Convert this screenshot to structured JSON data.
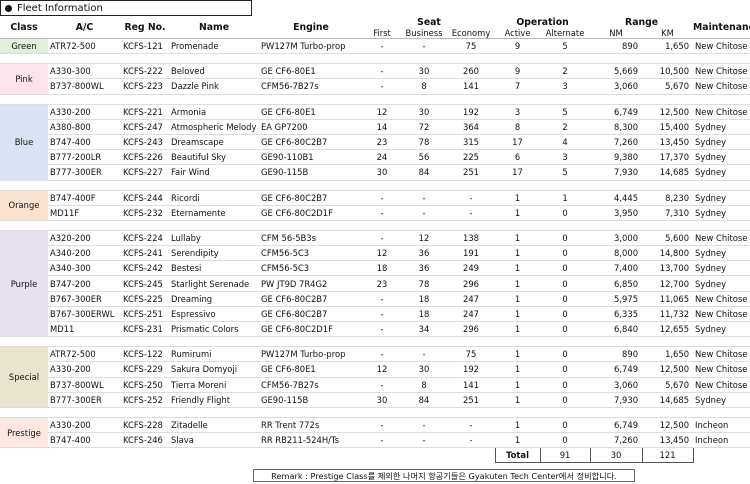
{
  "title": "Fleet Information",
  "headers": {
    "class": "Class",
    "ac": "A/C",
    "reg": "Reg No.",
    "name": "Name",
    "engine": "Engine",
    "seat": "Seat",
    "first": "First",
    "business": "Business",
    "economy": "Economy",
    "operation": "Operation",
    "active": "Active",
    "alternate": "Alternate",
    "range": "Range",
    "nm": "NM",
    "km": "KM",
    "maintenance": "Maintenance"
  },
  "groups": [
    {
      "class": "Green",
      "color": "#e2efda",
      "rows": [
        [
          "ATR72-500",
          "KCFS-121",
          "Promenade",
          "PW127M Turbo-prop",
          "-",
          "-",
          "75",
          "9",
          "5",
          "890",
          "1,650",
          "New Chitose"
        ]
      ]
    },
    {
      "class": "Pink",
      "color": "#fce4ec",
      "rows": [
        [
          "A330-300",
          "KCFS-222",
          "Beloved",
          "GE CF6-80E1",
          "-",
          "30",
          "260",
          "9",
          "2",
          "5,669",
          "10,500",
          "New Chitose"
        ],
        [
          "B737-800WL",
          "KCFS-223",
          "Dazzle Pink",
          "CFM56-7B27s",
          "-",
          "8",
          "141",
          "7",
          "3",
          "3,060",
          "5,670",
          "New Chitose"
        ]
      ]
    },
    {
      "class": "Blue",
      "color": "#dae3f3",
      "rows": [
        [
          "A330-200",
          "KCFS-221",
          "Armonia",
          "GE CF6-80E1",
          "12",
          "30",
          "192",
          "3",
          "5",
          "6,749",
          "12,500",
          "New Chitose"
        ],
        [
          "A380-800",
          "KCFS-247",
          "Atmospheric Melody",
          "EA GP7200",
          "14",
          "72",
          "364",
          "8",
          "2",
          "8,300",
          "15,400",
          "Sydney"
        ],
        [
          "B747-400",
          "KCFS-243",
          "Dreamscape",
          "GE CF6-80C2B7",
          "23",
          "78",
          "315",
          "17",
          "4",
          "7,260",
          "13,450",
          "Sydney"
        ],
        [
          "B777-200LR",
          "KCFS-226",
          "Beautiful Sky",
          "GE90-110B1",
          "24",
          "56",
          "225",
          "6",
          "3",
          "9,380",
          "17,370",
          "Sydney"
        ],
        [
          "B777-300ER",
          "KCFS-227",
          "Fair Wind",
          "GE90-115B",
          "30",
          "84",
          "251",
          "17",
          "5",
          "7,930",
          "14,685",
          "Sydney"
        ]
      ]
    },
    {
      "class": "Orange",
      "color": "#fbe3cf",
      "rows": [
        [
          "B747-400F",
          "KCFS-244",
          "Ricordi",
          "GE CF6-80C2B7",
          "-",
          "-",
          "-",
          "1",
          "1",
          "4,445",
          "8,230",
          "Sydney"
        ],
        [
          "MD11F",
          "KCFS-232",
          "Eternamente",
          "GE CF6-80C2D1F",
          "-",
          "-",
          "-",
          "1",
          "0",
          "3,950",
          "7,310",
          "Sydney"
        ]
      ]
    },
    {
      "class": "Purple",
      "color": "#e6e0ef",
      "rows": [
        [
          "A320-200",
          "KCFS-224",
          "Lullaby",
          "CFM 56-5B3s",
          "-",
          "12",
          "138",
          "1",
          "0",
          "3,000",
          "5,600",
          "New Chitose"
        ],
        [
          "A340-200",
          "KCFS-241",
          "Serendipity",
          "CFM56-5C3",
          "12",
          "36",
          "191",
          "1",
          "0",
          "8,000",
          "14,800",
          "Sydney"
        ],
        [
          "A340-300",
          "KCFS-242",
          "Bestesi",
          "CFM56-5C3",
          "18",
          "36",
          "249",
          "1",
          "0",
          "7,400",
          "13,700",
          "Sydney"
        ],
        [
          "B747-200",
          "KCFS-245",
          "Starlight Serenade",
          "PW JT9D 7R4G2",
          "23",
          "78",
          "296",
          "1",
          "0",
          "6,850",
          "12,700",
          "Sydney"
        ],
        [
          "B767-300ER",
          "KCFS-225",
          "Dreaming",
          "GE CF6-80C2B7",
          "-",
          "18",
          "247",
          "1",
          "0",
          "5,975",
          "11,065",
          "New Chitose"
        ],
        [
          "B767-300ERWL",
          "KCFS-251",
          "Espressivo",
          "GE CF6-80C2B7",
          "-",
          "18",
          "247",
          "1",
          "0",
          "6,335",
          "11,732",
          "New Chitose"
        ],
        [
          "MD11",
          "KCFS-231",
          "Prismatic Colors",
          "GE CF6-80C2D1F",
          "-",
          "34",
          "296",
          "1",
          "0",
          "6,840",
          "12,655",
          "Sydney"
        ]
      ]
    },
    {
      "class": "Special",
      "color": "#e8e4d0",
      "rows": [
        [
          "ATR72-500",
          "KCFS-122",
          "Rumirumi",
          "PW127M Turbo-prop",
          "-",
          "-",
          "75",
          "1",
          "0",
          "890",
          "1,650",
          "New Chitose"
        ],
        [
          "A330-200",
          "KCFS-229",
          "Sakura Domyoji",
          "GE CF6-80E1",
          "12",
          "30",
          "192",
          "1",
          "0",
          "6,749",
          "12,500",
          "New Chitose"
        ],
        [
          "B737-800WL",
          "KCFS-250",
          "Tierra Moreni",
          "CFM56-7B27s",
          "-",
          "8",
          "141",
          "1",
          "0",
          "3,060",
          "5,670",
          "New Chitose"
        ],
        [
          "B777-300ER",
          "KCFS-252",
          "Friendly Flight",
          "GE90-115B",
          "30",
          "84",
          "251",
          "1",
          "0",
          "7,930",
          "14,685",
          "Sydney"
        ]
      ]
    },
    {
      "class": "Prestige",
      "color": "#fde9e2",
      "rows": [
        [
          "A330-200",
          "KCFS-228",
          "Zitadelle",
          "RR Trent 772s",
          "-",
          "-",
          "-",
          "1",
          "0",
          "6,749",
          "12,500",
          "Incheon"
        ],
        [
          "B747-400",
          "KCFS-246",
          "Slava",
          "RR RB211-524H/Ts",
          "-",
          "-",
          "-",
          "1",
          "0",
          "7,260",
          "13,450",
          "Incheon"
        ]
      ]
    }
  ],
  "total": {
    "label": "Total",
    "active": "91",
    "alternate": "30",
    "count": "121"
  },
  "remark": "Remark : Prestige Class를 제외한 나머지 항공기들은 Gyakuten Tech Center에서 정비합니다."
}
